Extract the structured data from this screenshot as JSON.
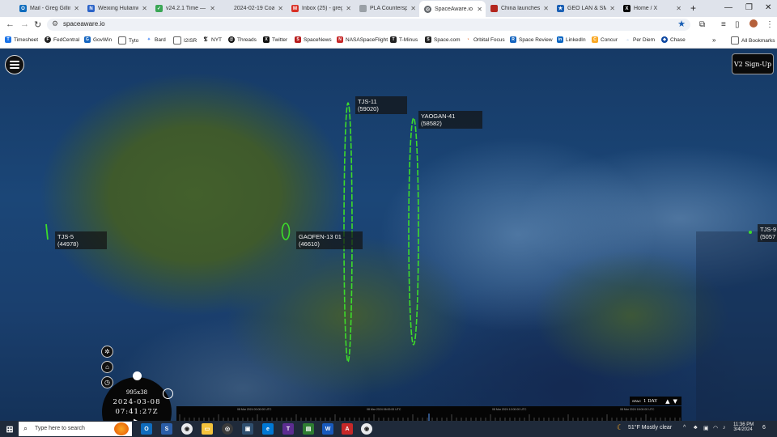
{
  "browser": {
    "tabs": [
      {
        "label": "Mail - Greg Gilling",
        "icon": "outlook-icon",
        "color": "#0f6cbd"
      },
      {
        "label": "Weixing Hulianwa",
        "icon": "n-icon",
        "color": "#2b63c8"
      },
      {
        "label": "v24.2.1 Time — T",
        "icon": "check-icon",
        "color": "#3aa655"
      },
      {
        "label": "2024-02-19 Coas",
        "icon": "blank-icon",
        "color": "#9aa0a6"
      },
      {
        "label": "Inbox (25) - greg",
        "icon": "gmail-icon",
        "color": "#d93025"
      },
      {
        "label": "PLA Counterspac",
        "icon": "doc-icon",
        "color": "#9aa0a6"
      },
      {
        "label": "SpaceAware.io",
        "icon": "globe-icon",
        "color": "#5f6368"
      },
      {
        "label": "China launches cl",
        "icon": "news-icon",
        "color": "#b3261e"
      },
      {
        "label": "GEO LAN & SMA",
        "icon": "star-icon",
        "color": "#1a5fb4"
      },
      {
        "label": "Home / X",
        "icon": "x-icon",
        "color": "#000000"
      }
    ],
    "url": "spaceaware.io",
    "new_tab": "+",
    "bookmarks": [
      {
        "label": "Timesheet",
        "icon": "timesheet-icon",
        "color": "#1a73e8"
      },
      {
        "label": "FedCentral",
        "icon": "fedcentral-icon",
        "color": "#222222"
      },
      {
        "label": "GovWin",
        "icon": "govwin-icon",
        "color": "#1565c0"
      },
      {
        "label": "Tyto",
        "icon": "folder-icon",
        "color": "#666666"
      },
      {
        "label": "Bard",
        "icon": "bard-icon",
        "color": "#4285f4"
      },
      {
        "label": "I2ISR",
        "icon": "folder-icon",
        "color": "#666666"
      },
      {
        "label": "NYT",
        "icon": "nyt-icon",
        "color": "#111111"
      },
      {
        "label": "Threads",
        "icon": "threads-icon",
        "color": "#111111"
      },
      {
        "label": "Twitter",
        "icon": "x-icon",
        "color": "#111111"
      },
      {
        "label": "SpaceNews",
        "icon": "spacenews-icon",
        "color": "#b71c1c"
      },
      {
        "label": "NASASpaceFlight",
        "icon": "nsf-icon",
        "color": "#c62828"
      },
      {
        "label": "T-Minus",
        "icon": "tminus-icon",
        "color": "#222222"
      },
      {
        "label": "Space.com",
        "icon": "spacecom-icon",
        "color": "#222222"
      },
      {
        "label": "Orbital Focus",
        "icon": "orbital-icon",
        "color": "#e65100"
      },
      {
        "label": "Space Review",
        "icon": "spacereview-icon",
        "color": "#1565c0"
      },
      {
        "label": "LinkedIn",
        "icon": "linkedin-icon",
        "color": "#0a66c2"
      },
      {
        "label": "Concur",
        "icon": "concur-icon",
        "color": "#f9a825"
      },
      {
        "label": "Per Diem",
        "icon": "arrow-icon",
        "color": "#1565c0"
      },
      {
        "label": "Chase",
        "icon": "chase-icon",
        "color": "#0d47a1"
      }
    ],
    "all_bookmarks": "All Bookmarks"
  },
  "app": {
    "signup_label": "V2 Sign-Up",
    "satellites": [
      {
        "name": "TJS-5",
        "id": "(44978)"
      },
      {
        "name": "GAOFEN-13 01",
        "id": "(46610)"
      },
      {
        "name": "TJS-11",
        "id": "(59020)"
      },
      {
        "name": "YAOGAN-41",
        "id": "(58582)"
      },
      {
        "name": "TJS-9",
        "id": "(5057"
      }
    ],
    "clock": {
      "scale": "995x38",
      "date": "2024-03-08",
      "time": "07:41:27Z",
      "play_icon": "▶"
    },
    "speed": {
      "label": "1 DAY",
      "prefix": "SPAC"
    },
    "timeline_ticks": [
      "08 Mar 2024 00:00:00 UTC",
      "08 Mar 2024 06:00:00 UTC",
      "08 Mar 2024 12:00:00 UTC",
      "08 Mar 2024 18:00:00 UTC"
    ]
  },
  "taskbar": {
    "search_placeholder": "Type here to search",
    "weather": "51°F  Mostly clear",
    "time": "11:36 PM",
    "date": "3/4/2024",
    "notifications": "6"
  }
}
